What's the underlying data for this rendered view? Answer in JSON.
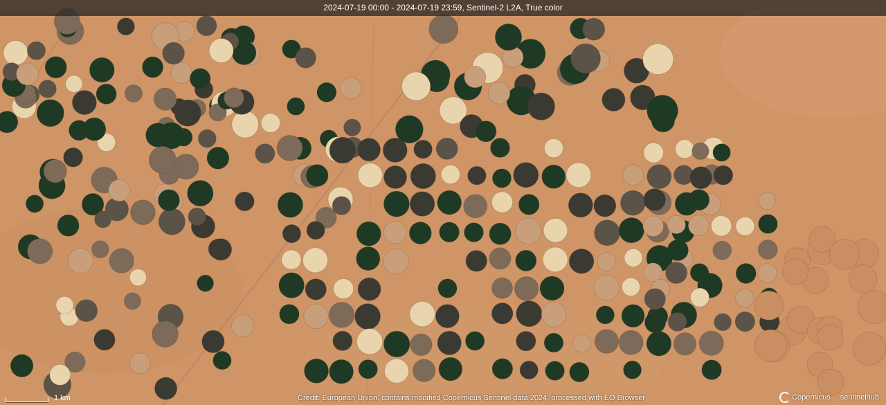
{
  "header": {
    "text": "2024-07-19 00:00 - 2024-07-19 23:59, Sentinel-2 L2A, True color"
  },
  "scale": {
    "label": "1 km"
  },
  "footer": {
    "credit": "Credit: European Union, contains modified Copernicus Sentinel data 2024, processed with EO Browser"
  },
  "logos": {
    "copernicus": "Copernicus",
    "sentinelhub": "sentinelhub"
  },
  "colors": {
    "desert": "#cf9566",
    "crop_dark": "#1f3a24",
    "crop_mid": "#5b5347",
    "fallow": "#c99e7a",
    "harvested": "#e9d5ad"
  }
}
